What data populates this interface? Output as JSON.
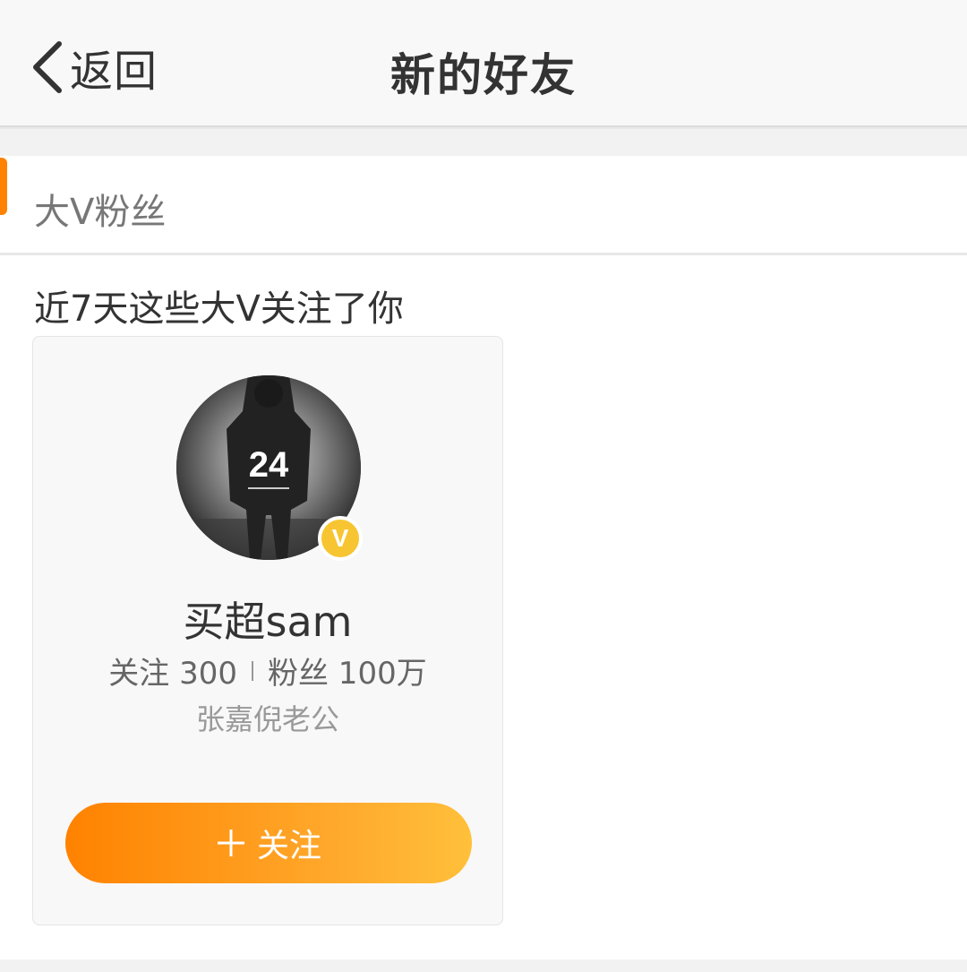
{
  "nav": {
    "back_label": "返回",
    "title": "新的好友"
  },
  "section": {
    "title": "大V粉丝",
    "accent_color": "#ff8200"
  },
  "subtitle": "近7天这些大V关注了你",
  "card": {
    "avatar_jersey_number": "24",
    "verified_badge": "V",
    "name": "买超sam",
    "following_label": "关注 300",
    "followers_label": "粉丝 100万",
    "description": "张嘉倪老公",
    "follow_button": {
      "icon": "plus-icon",
      "label": "关注"
    },
    "button_gradient": [
      "#ff8200",
      "#ffc03a"
    ],
    "badge_color": "#f7c531"
  }
}
